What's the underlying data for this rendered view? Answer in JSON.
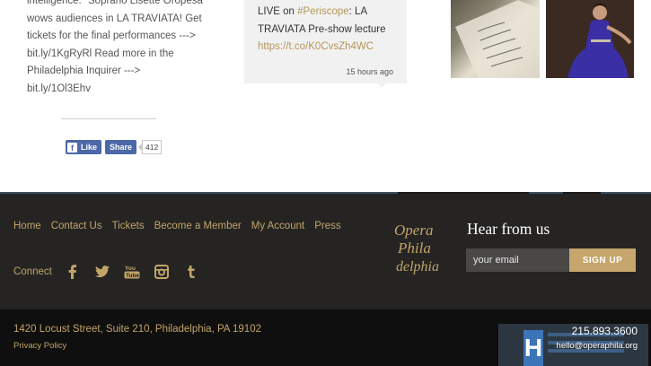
{
  "feed": {
    "lines": [
      "intelligence.\" Soprano Lisette Oropesa",
      "wows audiences in LA TRAVIATA! Get",
      "tickets for the final performances --->",
      "bit.ly/1KgRyRl Read more in the",
      "Philadelphia Inquirer --->",
      "bit.ly/1Ol3Ehv"
    ]
  },
  "facebook": {
    "like_label": "Like",
    "share_label": "Share",
    "share_count": "412"
  },
  "tweet": {
    "text_prefix": "LIVE on ",
    "hashtag": "#Periscope",
    "text_suffix": ": LA",
    "line2": "TRAVIATA Pre-show lecture",
    "link": "https://t.co/K0CvsZh4WC",
    "time": "15 hours ago"
  },
  "photos": {
    "letter_icon": "letter-photo",
    "singer_icon": "singer-photo"
  },
  "footer": {
    "nav": [
      "Home",
      "Contact Us",
      "Tickets",
      "Become a Member",
      "My Account",
      "Press"
    ],
    "connect_label": "Connect",
    "social_icons": [
      "facebook-icon",
      "twitter-icon",
      "youtube-icon",
      "instagram-icon",
      "tumblr-icon"
    ],
    "logo_text": "Opera Philadelphia",
    "hear_title": "Hear from us",
    "email_placeholder": "your email",
    "signup_label": "SIGN UP"
  },
  "bottom": {
    "address": "1420 Locust Street, Suite 210, Philadelphia, PA 19102",
    "privacy": "Privacy Policy",
    "phone": "215.893.3600",
    "email": "hello@operaphila.org"
  },
  "colors": {
    "gold": "#c2a468",
    "footer_bg": "#252423",
    "bottom_bg": "#0f0f0f",
    "facebook_blue": "#4c68a7",
    "tweet_bg": "#f1f1f1"
  }
}
